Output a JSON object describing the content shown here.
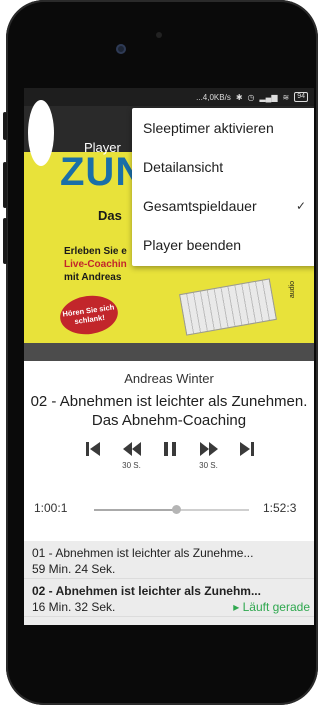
{
  "status_bar": {
    "speed": "...4,0KB/s",
    "battery": "94"
  },
  "cover": {
    "big_text": "ZUN",
    "small_text": "Das",
    "line1": "Erleben Sie e",
    "line2": "Live-Coachin",
    "line3": "mit Andreas",
    "badge": "Hören Sie sich schlank!",
    "vertical_label": "audio"
  },
  "appbar": {
    "title": "Player"
  },
  "menu": {
    "items": [
      {
        "label": "Sleeptimer aktivieren",
        "checked": false
      },
      {
        "label": "Detailansicht",
        "checked": false
      },
      {
        "label": "Gesamtspieldauer",
        "checked": true
      },
      {
        "label": "Player beenden",
        "checked": false
      }
    ],
    "check_glyph": "✓"
  },
  "player": {
    "author": "Andreas Winter",
    "title": "02 - Abnehmen ist leichter als Zunehmen. Das Abnehm-Coaching",
    "rewind_label": "30 S.",
    "forward_label": "30 S.",
    "current_time": "1:00:1",
    "total_time": "1:52:3",
    "progress_fraction": 0.53
  },
  "playlist": [
    {
      "title": "01 - Abnehmen ist leichter als Zunehme...",
      "duration": "59 Min. 24 Sek.",
      "active": false,
      "status": ""
    },
    {
      "title": "02 - Abnehmen ist leichter als Zunehm...",
      "duration": "16 Min. 32 Sek.",
      "active": true,
      "status": "▸ Läuft gerade"
    }
  ],
  "colors": {
    "accent_green": "#2fa84f",
    "cover_yellow": "#e8e23a",
    "cover_blue": "#1a6fa8",
    "badge_red": "#c2262b"
  }
}
